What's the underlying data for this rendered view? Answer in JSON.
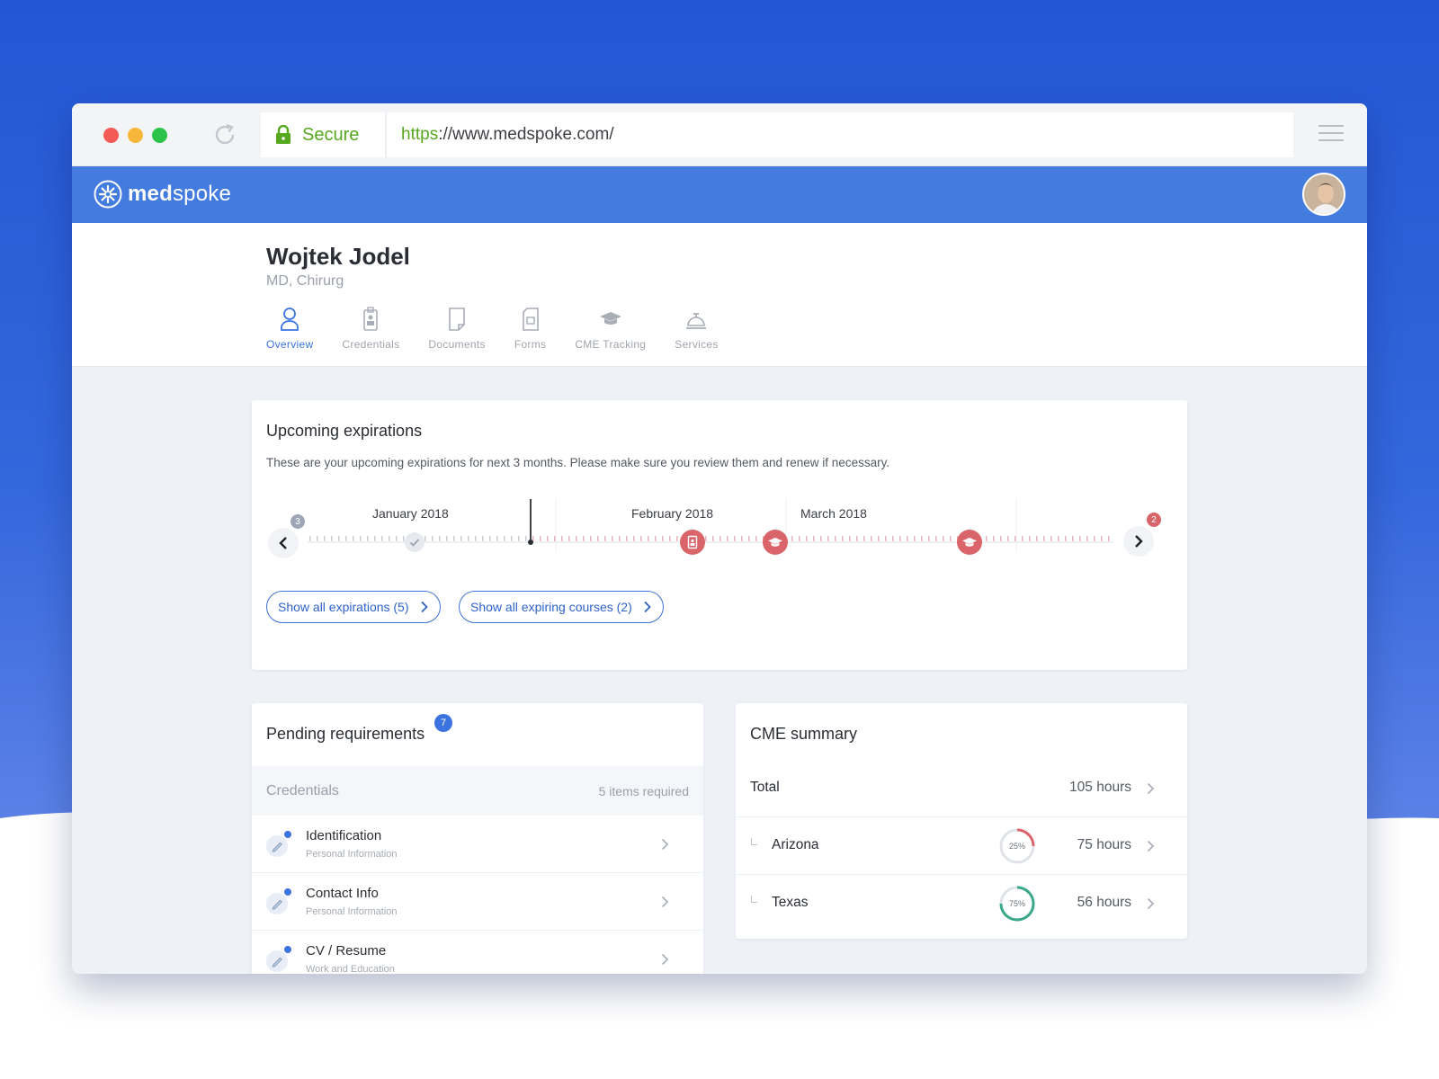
{
  "browser": {
    "secure_label": "Secure",
    "url_protocol": "https",
    "url_rest": "://www.medspoke.com/"
  },
  "app": {
    "logo_prefix": "med",
    "logo_suffix": "spoke"
  },
  "profile": {
    "name": "Wojtek Jodel",
    "subtitle": "MD, Chirurg",
    "tabs": [
      {
        "label": "Overview",
        "icon": "person-icon",
        "active": true
      },
      {
        "label": "Credentials",
        "icon": "id-badge-icon",
        "active": false
      },
      {
        "label": "Documents",
        "icon": "document-icon",
        "active": false
      },
      {
        "label": "Forms",
        "icon": "form-icon",
        "active": false
      },
      {
        "label": "CME Tracking",
        "icon": "graduation-cap-icon",
        "active": false
      },
      {
        "label": "Services",
        "icon": "service-bell-icon",
        "active": false
      }
    ]
  },
  "expirations": {
    "title": "Upcoming expirations",
    "description": "These are your upcoming expirations for next 3 months. Please make sure you review them and renew if necessary.",
    "months": [
      "January 2018",
      "February 2018",
      "March 2018"
    ],
    "prev_badge": "3",
    "next_badge": "2",
    "show_all_label": "Show all expirations (5)",
    "show_courses_label": "Show all expiring courses (2)"
  },
  "pending": {
    "title": "Pending requirements",
    "badge": "7",
    "section": {
      "name": "Credentials",
      "count": "5 items required"
    },
    "items": [
      {
        "name": "Identification",
        "sub": "Personal Information"
      },
      {
        "name": "Contact Info",
        "sub": "Personal Information"
      },
      {
        "name": "CV / Resume",
        "sub": "Work and Education"
      }
    ]
  },
  "cme": {
    "title": "CME summary",
    "total_label": "Total",
    "total_hours": "105 hours",
    "states": [
      {
        "name": "Arizona",
        "percent_label": "25%",
        "percent": 0.25,
        "hours": "75 hours",
        "color": "#d9656a"
      },
      {
        "name": "Texas",
        "percent_label": "75%",
        "percent": 0.75,
        "hours": "56 hours",
        "color": "#3aa98a"
      }
    ]
  },
  "colors": {
    "brand_blue": "#437bdf",
    "accent_blue": "#3b74e0",
    "alert_red": "#d9656a",
    "success_green": "#3aa98a"
  }
}
